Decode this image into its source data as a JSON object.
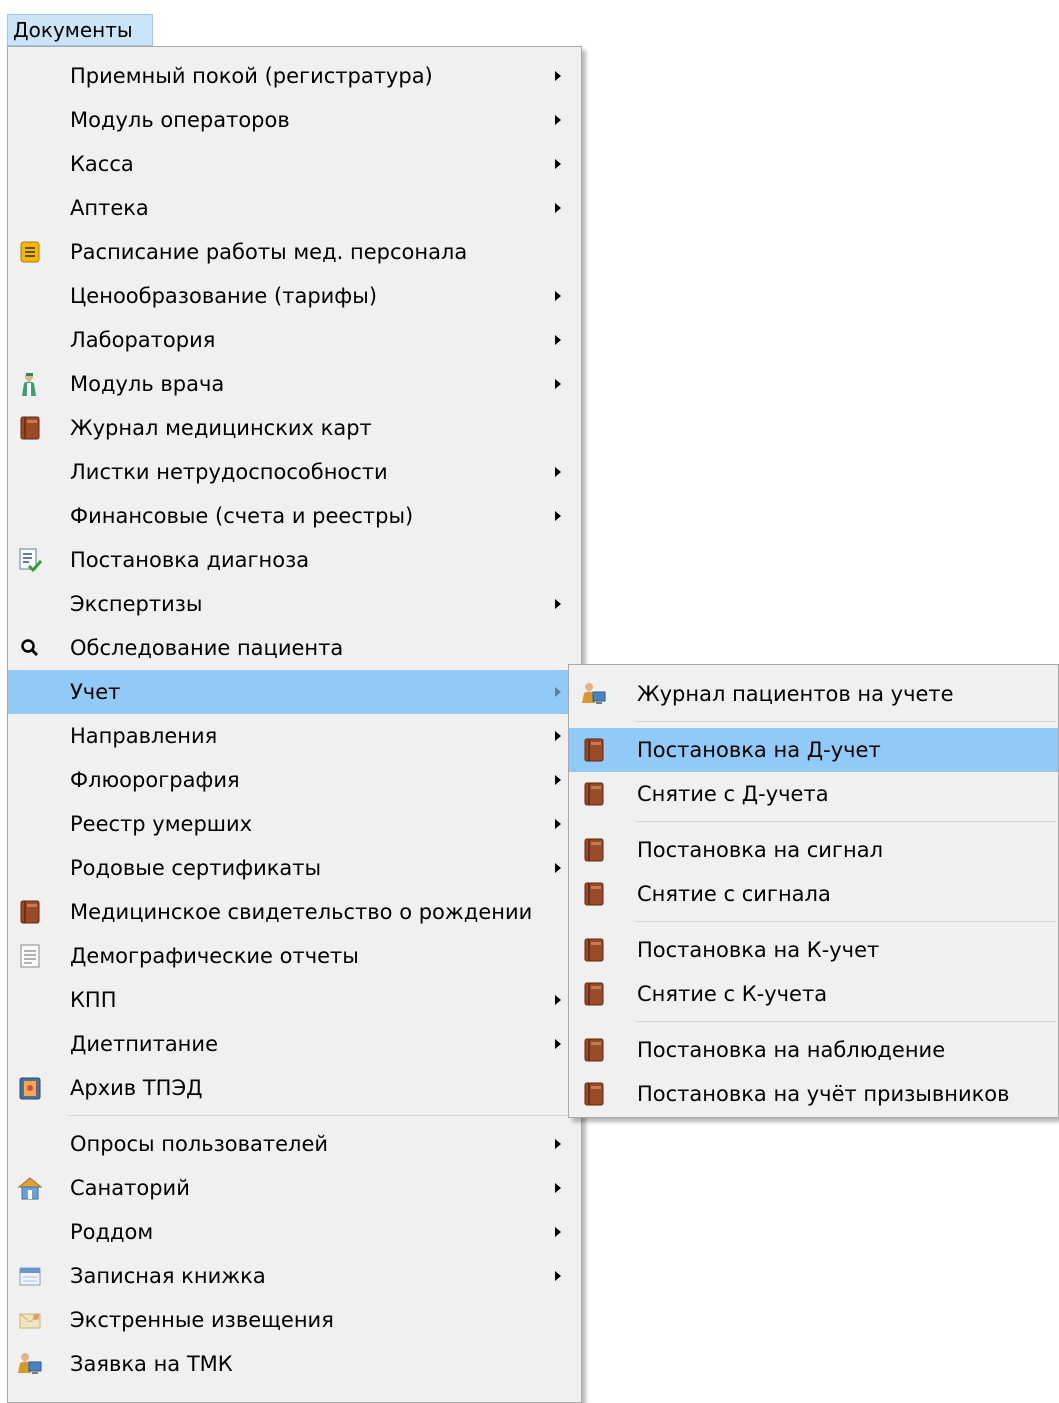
{
  "menubar": {
    "documents": "Документы"
  },
  "main_menu": {
    "items": [
      {
        "label": "Приемный покой (регистратура)",
        "submenu": true
      },
      {
        "label": "Модуль операторов",
        "submenu": true
      },
      {
        "label": "Касса",
        "submenu": true
      },
      {
        "label": "Аптека",
        "submenu": true
      },
      {
        "label": "Расписание работы мед. персонала",
        "icon": "schedule-note-icon"
      },
      {
        "label": "Ценообразование (тарифы)",
        "submenu": true
      },
      {
        "label": "Лаборатория",
        "submenu": true
      },
      {
        "label": "Модуль врача",
        "submenu": true,
        "icon": "doctor-icon"
      },
      {
        "label": "Журнал медицинских карт",
        "icon": "medical-book-icon"
      },
      {
        "label": "Листки нетрудоспособности",
        "submenu": true
      },
      {
        "label": "Финансовые (счета и реестры)",
        "submenu": true
      },
      {
        "label": "Постановка диагноза",
        "icon": "diagnosis-check-icon"
      },
      {
        "label": "Экспертизы",
        "submenu": true
      },
      {
        "label": "Обследование пациента",
        "icon": "magnifier-icon"
      },
      {
        "label": "Учет",
        "submenu": true,
        "highlighted": true
      },
      {
        "label": "Направления",
        "submenu": true
      },
      {
        "label": "Флюорография",
        "submenu": true
      },
      {
        "label": "Реестр умерших",
        "submenu": true
      },
      {
        "label": "Родовые сертификаты",
        "submenu": true
      },
      {
        "label": "Медицинское свидетельство о рождении",
        "icon": "medical-book-icon"
      },
      {
        "label": "Демографические отчеты",
        "icon": "document-icon"
      },
      {
        "label": "КПП",
        "submenu": true
      },
      {
        "label": "Диетпитание",
        "submenu": true
      },
      {
        "label": "Архив ТПЭД",
        "icon": "archive-icon"
      },
      {
        "label": "Опросы пользователей",
        "submenu": true
      },
      {
        "label": "Санаторий",
        "submenu": true,
        "icon": "sanatorium-icon"
      },
      {
        "label": "Роддом",
        "submenu": true
      },
      {
        "label": "Записная книжка",
        "submenu": true,
        "icon": "notebook-icon"
      },
      {
        "label": "Экстренные извещения",
        "icon": "envelope-icon"
      },
      {
        "label": "Заявка на ТМК",
        "icon": "user-computer-icon"
      }
    ]
  },
  "sub_menu": {
    "items": [
      {
        "label": "Журнал пациентов на учете",
        "icon": "user-computer-icon"
      },
      {
        "label": "Постановка на Д-учет",
        "icon": "medical-book-icon",
        "highlighted": true
      },
      {
        "label": "Снятие с Д-учета",
        "icon": "medical-book-icon"
      },
      {
        "label": "Постановка на сигнал",
        "icon": "medical-book-icon"
      },
      {
        "label": "Снятие с сигнала",
        "icon": "medical-book-icon"
      },
      {
        "label": "Постановка на К-учет",
        "icon": "medical-book-icon"
      },
      {
        "label": "Снятие с К-учета",
        "icon": "medical-book-icon"
      },
      {
        "label": "Постановка на наблюдение",
        "icon": "medical-book-icon"
      },
      {
        "label": "Постановка на учёт призывников",
        "icon": "medical-book-icon"
      }
    ]
  }
}
